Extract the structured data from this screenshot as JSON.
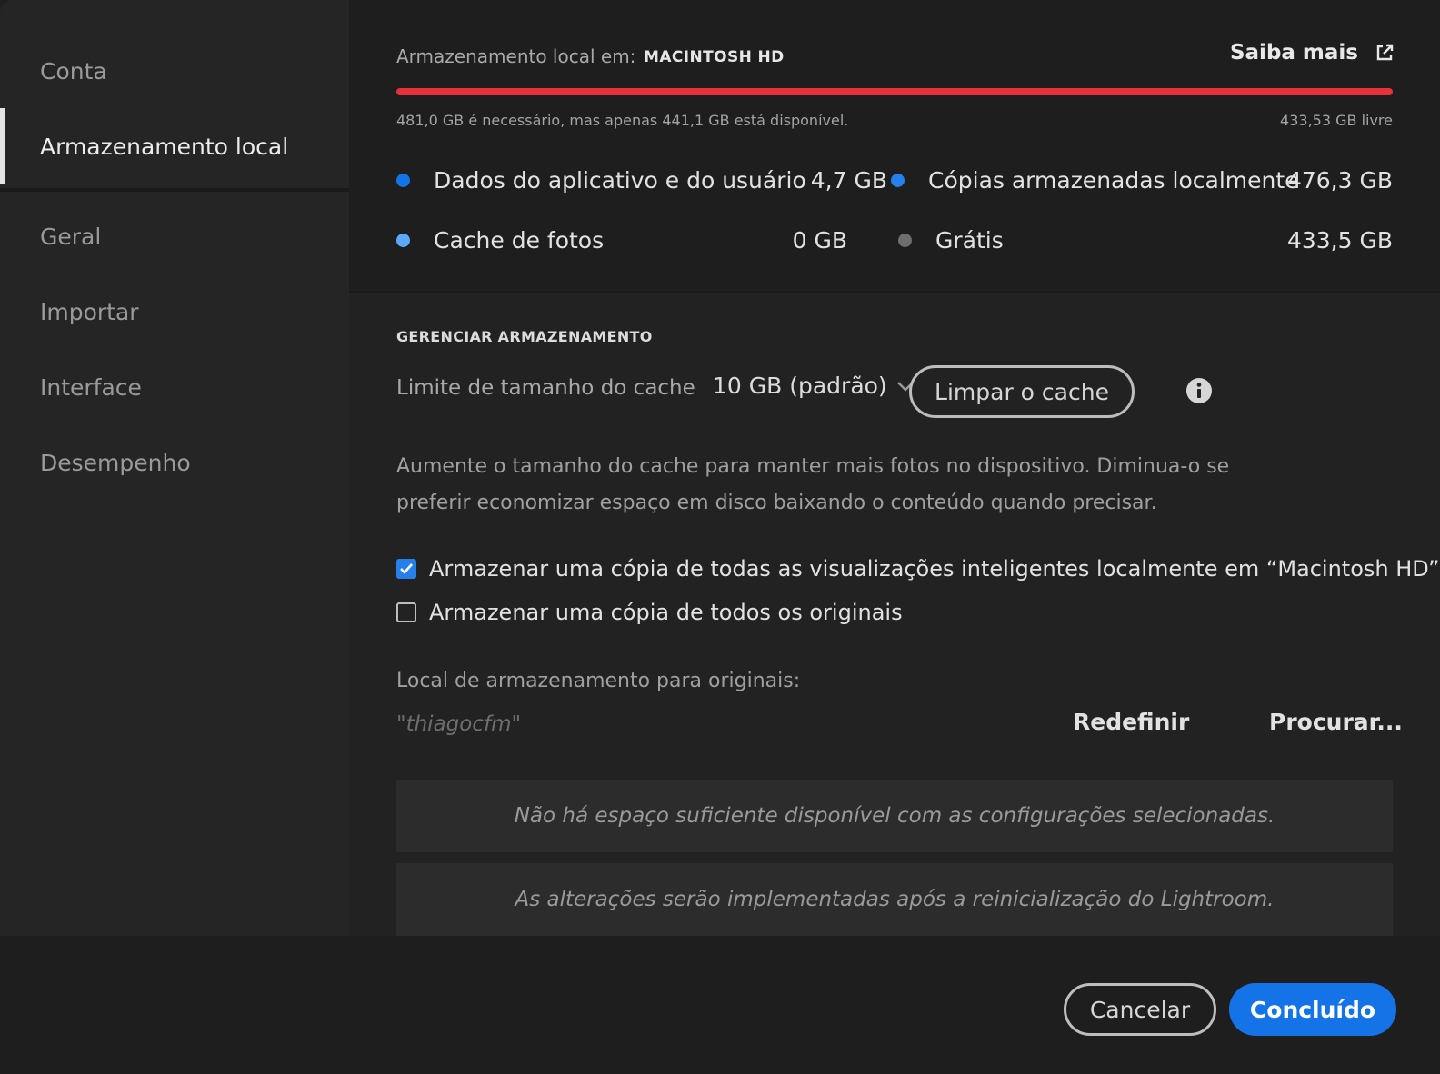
{
  "sidebar": {
    "items": [
      {
        "label": "Conta"
      },
      {
        "label": "Armazenamento local"
      },
      {
        "label": "Geral"
      },
      {
        "label": "Importar"
      },
      {
        "label": "Interface"
      },
      {
        "label": "Desempenho"
      }
    ],
    "active_item": "Armazenamento local"
  },
  "storage": {
    "location_label": "Armazenamento local em:",
    "drive_name": "MACINTOSH HD",
    "learn_more": "Saiba mais",
    "learn_more_icon": "external-link-icon",
    "usage_bar_color": "#e8323b",
    "usage_fraction": 1.0,
    "requirement_text": "481,0 GB é necessário, mas apenas 441,1 GB está disponível.",
    "free_text": "433,53 GB livre",
    "legend": [
      {
        "label": "Dados do aplicativo e do usuário",
        "value": "4,7 GB",
        "color": "#1473e6"
      },
      {
        "label": "Cópias armazenadas localmente",
        "value": "476,3 GB",
        "color": "#2680eb"
      },
      {
        "label": "Cache de fotos",
        "value": "0 GB",
        "color": "#5aa9fa"
      },
      {
        "label": "Grátis",
        "value": "433,5 GB",
        "color": "#6e6e6e"
      }
    ]
  },
  "manage": {
    "title": "GERENCIAR ARMAZENAMENTO",
    "cache_limit_label": "Limite de tamanho do cache",
    "cache_limit_value": "10 GB (padrão)",
    "clear_cache_button": "Limpar o cache",
    "info_icon": "info-icon",
    "description": "Aumente o tamanho do cache para manter mais fotos no dispositivo. Diminua-o se preferir economizar espaço em disco baixando o conteúdo quando precisar.",
    "options": [
      {
        "label": "Armazenar uma cópia de todas as visualizações inteligentes localmente em “Macintosh HD”",
        "checked": true
      },
      {
        "label": "Armazenar uma cópia de todos os originais",
        "checked": false
      }
    ],
    "originals_location_label": "Local de armazenamento para originais:",
    "originals_location_value": "\"thiagocfm\"",
    "reset_button": "Redefinir",
    "browse_button": "Procurar...",
    "messages": [
      "Não há espaço suficiente disponível com as configurações selecionadas.",
      "As alterações serão implementadas após a reinicialização do Lightroom."
    ]
  },
  "footer": {
    "cancel_button": "Cancelar",
    "done_button": "Concluído",
    "done_color": "#1473e6"
  }
}
